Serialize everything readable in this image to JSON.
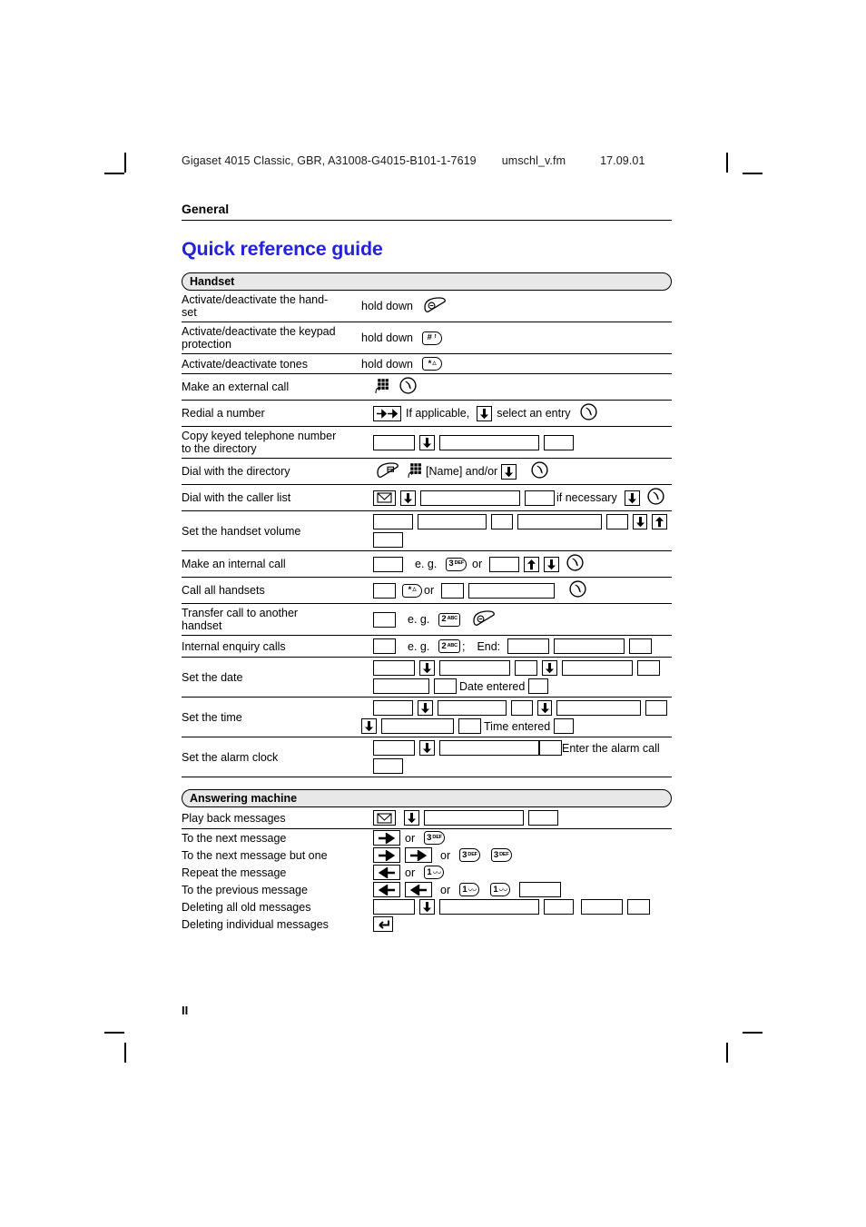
{
  "header": {
    "document": "Gigaset 4015 Classic, GBR, A31008-G4015-B101-1-7619",
    "file": "umschl_v.fm",
    "date": "17.09.01"
  },
  "chapter_label": "General",
  "title": "Quick reference guide",
  "title_color": "#2222dd",
  "band_color": "#e8e8e8",
  "folio": "II",
  "sections": [
    {
      "band": "Handset",
      "rows": [
        {
          "label": "Activate/deactivate the hand-\nset",
          "prefix": "hold down",
          "keys": [
            "hangup-key"
          ]
        },
        {
          "label": "Activate/deactivate the keypad\nprotection",
          "prefix": "hold down",
          "keys": [
            "hash-key"
          ]
        },
        {
          "label": "Activate/deactivate tones",
          "prefix": "hold down",
          "keys": [
            "star-key"
          ]
        },
        {
          "label": "Make an external call",
          "keys": [
            "keypad-icon",
            "call-icon"
          ]
        },
        {
          "label": "Redial a number",
          "seq_text": [
            "If applicable,",
            "select an entry"
          ]
        },
        {
          "label": "Copy keyed telephone number\nto the directory"
        },
        {
          "label": "Dial with the directory",
          "seq_text": [
            "[Name] and/or"
          ]
        },
        {
          "label": "Dial with the caller list",
          "seq_text": [
            "if  necessary"
          ]
        },
        {
          "label": "Set the handset volume"
        },
        {
          "label": "Make an internal call",
          "seq_text": [
            "e. g.",
            "or"
          ],
          "keys": [
            "3-def-key"
          ]
        },
        {
          "label": "Call all handsets",
          "seq_text": [
            "or"
          ],
          "keys": [
            "star-key",
            "call-icon"
          ]
        },
        {
          "label": "Transfer call to another\nhandset",
          "seq_text": [
            "e. g."
          ],
          "keys": [
            "2-abc-key",
            "hangup-key"
          ]
        },
        {
          "label": "Internal enquiry calls",
          "seq_text": [
            "e. g.",
            ";",
            "End:"
          ],
          "keys": [
            "2-abc-key"
          ]
        },
        {
          "label": "Set the date",
          "seq_text": [
            "Date entered"
          ]
        },
        {
          "label": "Set the time",
          "seq_text": [
            "Time entered"
          ]
        },
        {
          "label": "Set the alarm clock",
          "seq_text": [
            "Enter the alarm call"
          ]
        }
      ]
    },
    {
      "band": "Answering machine",
      "rows": [
        {
          "label": "Play back messages"
        },
        {
          "label": "To the next message",
          "seq_text": [
            "or"
          ],
          "keys": [
            "right-arrow-key",
            "3-def-key"
          ]
        },
        {
          "label": "To the next message but one",
          "seq_text": [
            "or"
          ],
          "keys": [
            "right-arrow-key",
            "right-arrow-key",
            "3-def-key",
            "3-def-key"
          ]
        },
        {
          "label": "Repeat the message",
          "seq_text": [
            "or"
          ],
          "keys": [
            "left-arrow-key",
            "1-key"
          ]
        },
        {
          "label": "To the previous message",
          "seq_text": [
            "or"
          ],
          "keys": [
            "left-arrow-key",
            "left-arrow-key",
            "1-key",
            "1-key"
          ]
        },
        {
          "label": "Deleting all old messages"
        },
        {
          "label": "Deleting individual messages",
          "keys": [
            "return-arrow-key"
          ]
        }
      ]
    }
  ],
  "labels": {
    "hold_down": "hold down",
    "if_applicable": "If applicable,",
    "select_an_entry": "select an entry",
    "name_andor": "[Name] and/or",
    "if_necessary": "if  necessary",
    "eg": "e. g.",
    "or": "or",
    "semicolon": ";",
    "end": "End:",
    "date_entered": "Date entered",
    "time_entered": "Time entered",
    "enter_alarm_call": "Enter the alarm call",
    "r1_label_a": "Activate/deactivate the hand-",
    "r1_label_b": "set",
    "r2_label_a": "Activate/deactivate the keypad",
    "r2_label_b": "protection",
    "r3_label": "Activate/deactivate tones",
    "r4_label": "Make an external call",
    "r5_label": "Redial a number",
    "r6_label_a": "Copy keyed telephone number",
    "r6_label_b": "to the directory",
    "r7_label": "Dial with the directory",
    "r8_label": "Dial with the caller list",
    "r9_label": "Set the handset volume",
    "r10_label": "Make an internal call",
    "r11_label": "Call all handsets",
    "r12_label_a": "Transfer call to another",
    "r12_label_b": "handset",
    "r13_label": "Internal enquiry calls",
    "r14_label": "Set the date",
    "r15_label": "Set the time",
    "r16_label": "Set the alarm clock",
    "a1_label": "Play back messages",
    "a2_label": "To the next message",
    "a3_label": "To the next message but one",
    "a4_label": "Repeat the message",
    "a5_label": "To the previous message",
    "a6_label": "Deleting all old messages",
    "a7_label": "Deleting individual messages",
    "key_hash": "#",
    "key_star": "*",
    "key_3": "3",
    "key_3_sub": "DEF",
    "key_2": "2",
    "key_2_sub": "ABC",
    "key_1": "1",
    "key_1_sub": "∞"
  }
}
